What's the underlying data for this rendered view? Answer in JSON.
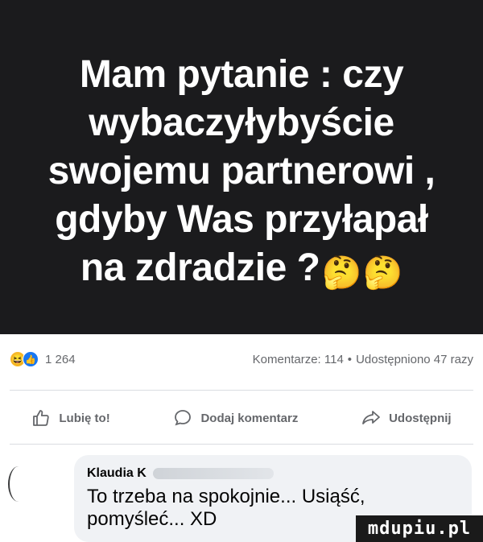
{
  "post": {
    "lines": [
      "Mam pytanie : czy",
      "wybaczyłybyście",
      "swojemu partnerowi ,",
      "gdyby Was przyłapał",
      "na zdradzie ?"
    ],
    "emoji": "🤔"
  },
  "stats": {
    "reaction_count": "1 264",
    "comments": "Komentarze: 114",
    "separator": "•",
    "shares": "Udostępniono 47 razy",
    "reaction_icons": [
      "haha-icon",
      "like-icon"
    ]
  },
  "actions": {
    "like_label": "Lubię to!",
    "comment_label": "Dodaj komentarz",
    "share_label": "Udostępnij"
  },
  "comment": {
    "author": "Klaudia K",
    "lines": [
      "To trzeba na spokojnie... Usiąść,",
      "pomyśleć... XD"
    ]
  },
  "watermark": "mdupiu.pl",
  "colors": {
    "image_bg": "#1b1b1d",
    "facebook_blue": "#1877f2",
    "haha_yellow": "#f7b928",
    "muted_text": "#65676b",
    "bubble_bg": "#f0f2f5"
  }
}
